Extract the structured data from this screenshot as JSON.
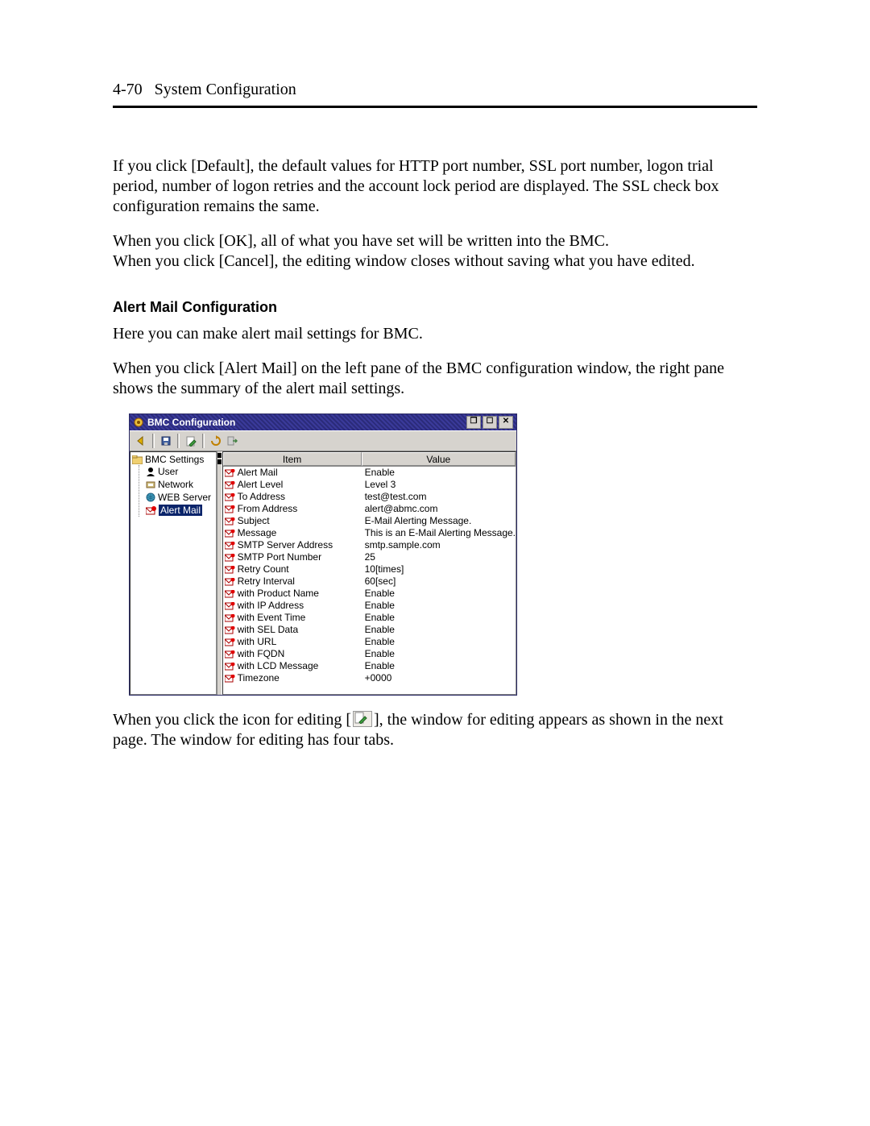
{
  "page": {
    "number": "4-70",
    "title": "System Configuration"
  },
  "paragraphs": {
    "p1": "If you click [Default], the default values for HTTP port number, SSL port number, logon trial period, number of logon retries and the account lock period are displayed. The SSL check box configuration remains the same.",
    "p2": "When you click [OK], all of what you have set will be written into the BMC.",
    "p3": "When you click [Cancel], the editing window closes without saving what you have edited.",
    "heading": "Alert Mail Configuration",
    "p4": "Here you can make alert mail settings for BMC.",
    "p5": "When you click [Alert Mail] on the left pane of the BMC configuration window, the right pane shows the summary of the alert mail settings.",
    "p6a": "When you click the icon for editing [",
    "p6b": "], the window for editing appears as shown in the next page. The window for editing has four tabs."
  },
  "window": {
    "title": "BMC Configuration",
    "columns": {
      "item": "Item",
      "value": "Value"
    },
    "tree": {
      "root": "BMC Settings",
      "items": [
        "User",
        "Network",
        "WEB Server",
        "Alert Mail"
      ]
    },
    "rows": [
      {
        "item": "Alert Mail",
        "value": "Enable"
      },
      {
        "item": "Alert Level",
        "value": "Level 3"
      },
      {
        "item": "To Address",
        "value": "test@test.com"
      },
      {
        "item": "From Address",
        "value": "alert@abmc.com"
      },
      {
        "item": "Subject",
        "value": "E-Mail Alerting Message."
      },
      {
        "item": "Message",
        "value": "This is an E-Mail Alerting Message."
      },
      {
        "item": "SMTP Server Address",
        "value": "smtp.sample.com"
      },
      {
        "item": "SMTP Port Number",
        "value": "25"
      },
      {
        "item": "Retry Count",
        "value": "10[times]"
      },
      {
        "item": "Retry Interval",
        "value": "60[sec]"
      },
      {
        "item": "with Product Name",
        "value": "Enable"
      },
      {
        "item": "with IP Address",
        "value": "Enable"
      },
      {
        "item": "with Event Time",
        "value": "Enable"
      },
      {
        "item": "with SEL Data",
        "value": "Enable"
      },
      {
        "item": "with URL",
        "value": "Enable"
      },
      {
        "item": "with FQDN",
        "value": "Enable"
      },
      {
        "item": "with LCD Message",
        "value": "Enable"
      },
      {
        "item": "Timezone",
        "value": "+0000"
      }
    ]
  }
}
